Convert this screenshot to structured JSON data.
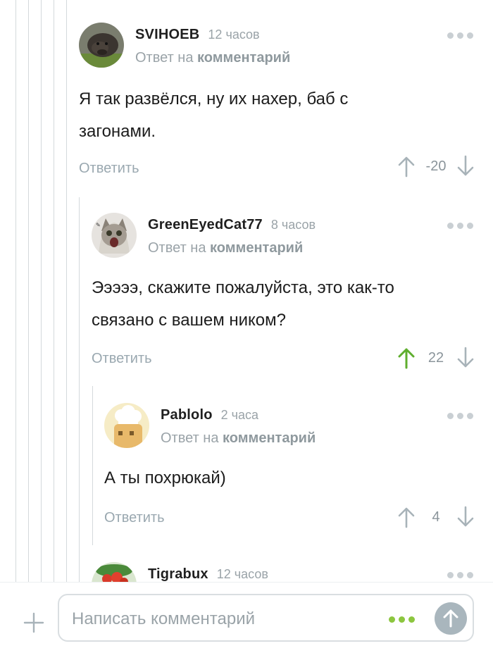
{
  "comments": [
    {
      "author": "SVIHOEB",
      "time": "12 часов",
      "reply_prefix": "Ответ на",
      "reply_link": "комментарий",
      "body": "Я так развёлся, ну их нахер, баб с загонами.",
      "reply_label": "Ответить",
      "rating": "-20"
    },
    {
      "author": "GreenEyedCat77",
      "time": "8 часов",
      "reply_prefix": "Ответ на",
      "reply_link": "комментарий",
      "body": "Эээээ, скажите пожалуйста, это как-то связано с вашем ником?",
      "reply_label": "Ответить",
      "rating": "22"
    },
    {
      "author": "Pablolo",
      "time": "2 часа",
      "reply_prefix": "Ответ на",
      "reply_link": "комментарий",
      "body": "А ты похрюкай)",
      "reply_label": "Ответить",
      "rating": "4"
    },
    {
      "author": "Tigrabux",
      "time": "12 часов"
    }
  ],
  "composer": {
    "placeholder": "Написать комментарий"
  },
  "colors": {
    "upvote_active": "#5fae2e",
    "accent_dots": "#8cc63f",
    "muted": "#9aa3a8"
  }
}
